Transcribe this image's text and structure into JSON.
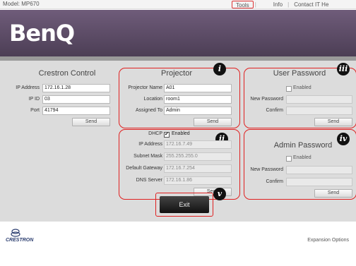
{
  "topbar": {
    "model": "Model: MP670",
    "nav": [
      "Tools",
      "Info",
      "Contact IT He"
    ]
  },
  "brand": {
    "logo": "BenQ"
  },
  "crestron_control": {
    "title": "Crestron Control",
    "fields": [
      {
        "label": "IP Address",
        "value": "172.16.1.28"
      },
      {
        "label": "IP ID",
        "value": "03"
      },
      {
        "label": "Port",
        "value": "41794"
      }
    ],
    "send_label": "Send"
  },
  "projector": {
    "title": "Projector",
    "badge": "i",
    "fields": [
      {
        "label": "Projector Name",
        "value": "A01"
      },
      {
        "label": "Location",
        "value": "room1"
      },
      {
        "label": "Assigned To",
        "value": "Admin"
      }
    ],
    "send_label": "Send"
  },
  "network": {
    "badge": "ii",
    "dhcp_label": "DHCP",
    "dhcp_enabled_label": "Enabled",
    "dhcp_enabled": true,
    "fields": [
      {
        "label": "IP Address",
        "value": "172.16.7.49"
      },
      {
        "label": "Subnet Mask",
        "value": "255.255.255.0"
      },
      {
        "label": "Default Gateway",
        "value": "172.16.7.254"
      },
      {
        "label": "DNS Server",
        "value": "172.16.1.86"
      }
    ],
    "send_label": "Send"
  },
  "user_password": {
    "title": "User Password",
    "badge": "iii",
    "enabled_label": "Enabled",
    "new_label": "New Password",
    "confirm_label": "Confirm",
    "send_label": "Send"
  },
  "admin_password": {
    "title": "Admin Password",
    "badge": "iv",
    "enabled_label": "Enabled",
    "new_label": "New Password",
    "confirm_label": "Confirm",
    "send_label": "Send"
  },
  "exit": {
    "label": "Exit",
    "badge": "v"
  },
  "footer": {
    "crestron_logo": "CRESTRON",
    "expansion": "Expansion Options"
  },
  "colors": {
    "header": "#5e4d69",
    "callout": "#e02020",
    "panel": "#dcdcdc"
  }
}
